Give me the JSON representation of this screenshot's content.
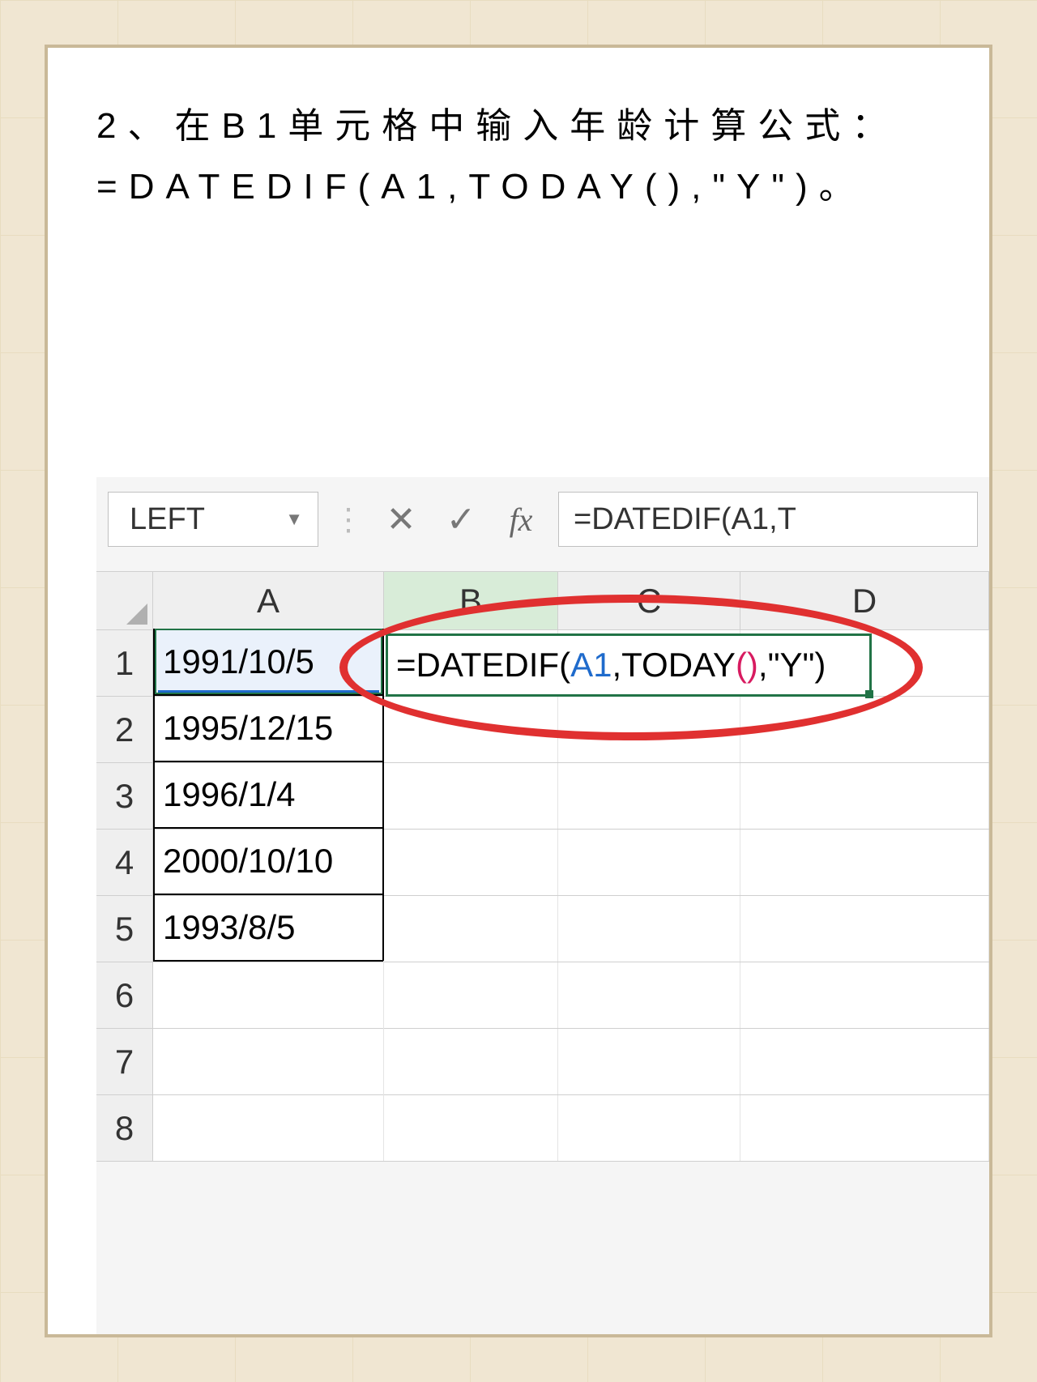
{
  "instruction": {
    "line1": "2、在B1单元格中输入年龄计算公式：",
    "line2": "=DATEDIF(A1,TODAY(),\"Y\")。"
  },
  "excel": {
    "name_box": "LEFT",
    "fx_icons": {
      "cancel": "✕",
      "enter": "✓",
      "fx": "fx"
    },
    "formula_bar_partial": "=DATEDIF(A1,T",
    "columns": [
      "A",
      "B",
      "C",
      "D"
    ],
    "rows": [
      1,
      2,
      3,
      4,
      5,
      6,
      7,
      8
    ],
    "data_a": [
      "1991/10/5",
      "1995/12/15",
      "1996/1/4",
      "2000/10/10",
      "1993/8/5"
    ],
    "formula_parts": {
      "p1": "=DATEDIF(",
      "ref": "A1",
      "p2": ",TODAY",
      "paren": "()",
      "p3": ",\"Y\")"
    }
  }
}
